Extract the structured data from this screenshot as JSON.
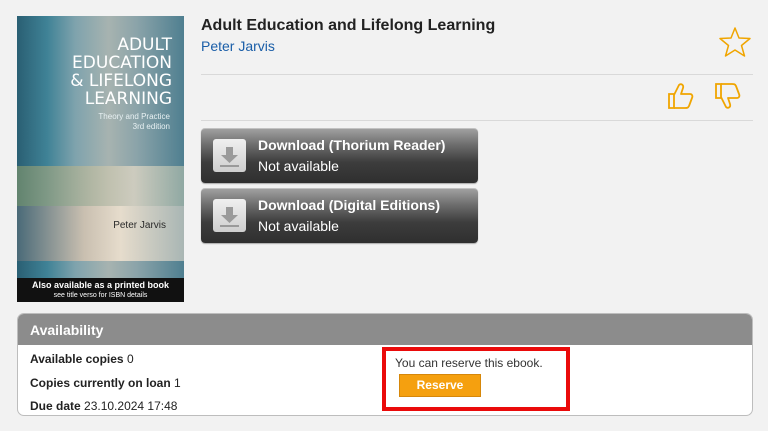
{
  "book": {
    "title": "Adult Education and Lifelong Learning",
    "author": "Peter Jarvis",
    "cover": {
      "title_lines": [
        "ADULT",
        "EDUCATION",
        "& LIFELONG",
        "LEARNING"
      ],
      "subtitle": "Theory and Practice",
      "edition": "3rd edition",
      "author": "Peter Jarvis",
      "banner_line1": "Also available as a printed book",
      "banner_line2": "see title verso for ISBN details"
    }
  },
  "actions": {
    "favorite_icon": "star-outline-icon",
    "like_icon": "thumbs-up-icon",
    "dislike_icon": "thumbs-down-icon"
  },
  "downloads": [
    {
      "label": "Download (Thorium Reader)",
      "status": "Not available",
      "icon": "download-icon"
    },
    {
      "label": "Download (Digital Editions)",
      "status": "Not available",
      "icon": "download-icon"
    }
  ],
  "availability": {
    "header": "Availability",
    "available_copies_label": "Available copies",
    "available_copies_value": "0",
    "on_loan_label": "Copies currently on loan",
    "on_loan_value": "1",
    "due_date_label": "Due date",
    "due_date_value": "23.10.2024 17:48",
    "reserve_text": "You can reserve this ebook.",
    "reserve_button": "Reserve"
  },
  "colors": {
    "accent_orange": "#f5a00f",
    "link_blue": "#1a5ea8",
    "highlight_red": "#ea0a0a",
    "header_grey": "#8c8c8c"
  }
}
